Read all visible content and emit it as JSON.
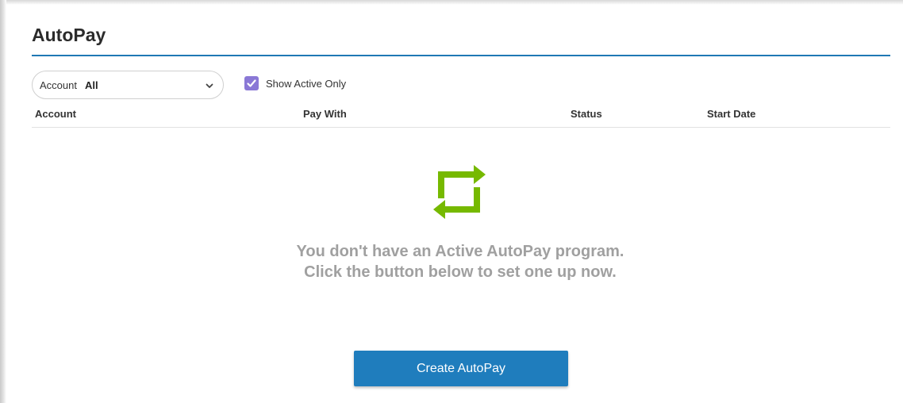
{
  "page": {
    "title": "AutoPay"
  },
  "filters": {
    "account_label": "Account",
    "account_value": "All",
    "show_active_label": "Show Active Only",
    "show_active_checked": true
  },
  "table": {
    "columns": [
      "Account",
      "Pay With",
      "Status",
      "Start Date"
    ]
  },
  "empty_state": {
    "icon": "repeat-arrows-icon",
    "line1": "You don't have an Active AutoPay program.",
    "line2": "Click the button below to set one up now."
  },
  "actions": {
    "create_label": "Create AutoPay"
  },
  "colors": {
    "accent_blue": "#1f7dbd",
    "title_rule": "#1f78b4",
    "icon_green": "#76b900",
    "checkbox_purple": "#8a78d6",
    "empty_text": "#a0a0a0"
  }
}
